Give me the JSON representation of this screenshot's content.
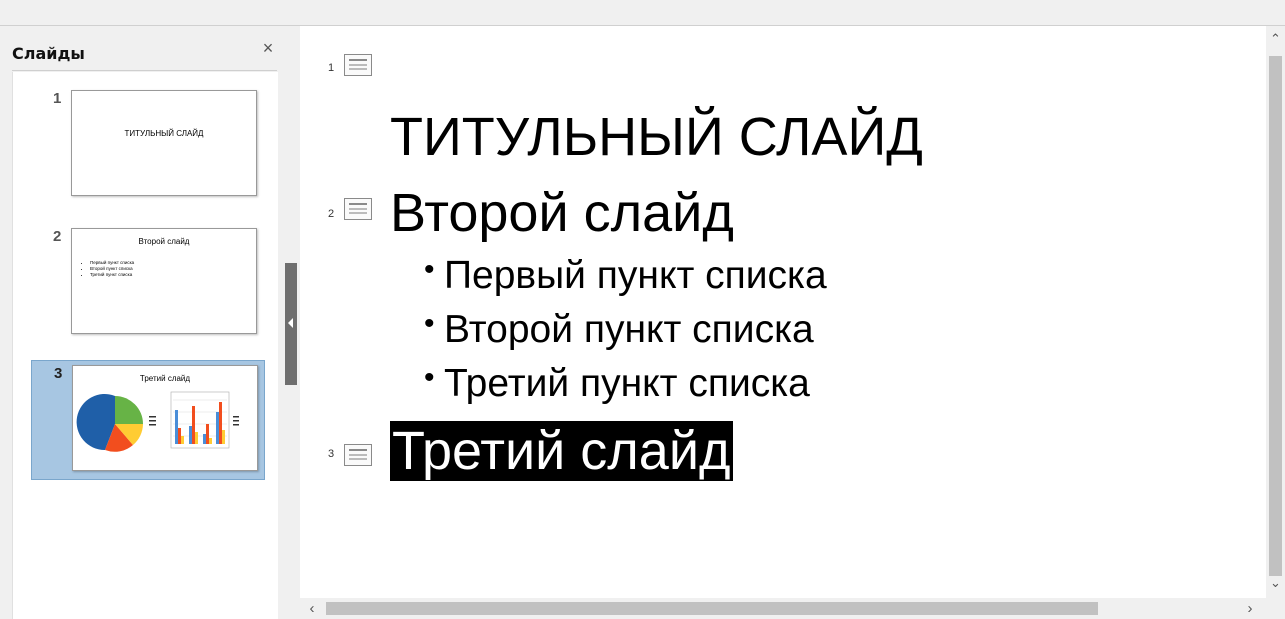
{
  "slides_pane": {
    "title": "Слайды",
    "close_glyph": "×",
    "thumbnails": [
      {
        "number": "1",
        "title": "ТИТУЛЬНЫЙ СЛАЙД"
      },
      {
        "number": "2",
        "title": "Второй слайд",
        "bullets": [
          "Первый пункт списка",
          "Второй пункт списка",
          "Третий пункт списка"
        ]
      },
      {
        "number": "3",
        "title": "Третий слайд",
        "selected": true
      }
    ]
  },
  "outline": {
    "slides": [
      {
        "number": "1",
        "title": "ТИТУЛЬНЫЙ СЛАЙД"
      },
      {
        "number": "2",
        "title": "Второй слайд",
        "bullets": [
          "Первый пункт списка",
          "Второй пункт списка",
          "Третий пункт списка"
        ]
      },
      {
        "number": "3",
        "title": "Третий слайд",
        "selected": true
      }
    ]
  },
  "icons": {
    "slide": "slide-icon",
    "close": "close-icon",
    "scroll_up": "chevron-up-icon",
    "scroll_down": "chevron-down-icon",
    "scroll_left": "chevron-left-icon",
    "scroll_right": "chevron-right-icon"
  },
  "scroll_glyphs": {
    "up": "⌃",
    "down": "⌄",
    "left": "‹",
    "right": "›"
  },
  "colors": {
    "selection": "#a7c6e2",
    "text_highlight": "#000000",
    "pie": [
      "#1f5fa8",
      "#f24e1e",
      "#ffcc33",
      "#67b346"
    ],
    "bars": [
      "#4a8ed8",
      "#f24e1e",
      "#ffcc33"
    ]
  }
}
